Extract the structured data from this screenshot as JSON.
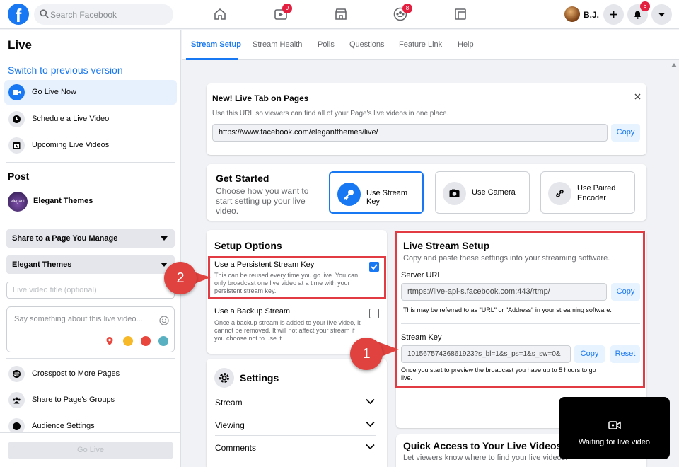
{
  "topbar": {
    "search_placeholder": "Search Facebook",
    "nav": [
      {
        "name": "home",
        "badge": ""
      },
      {
        "name": "watch",
        "badge": "9"
      },
      {
        "name": "marketplace",
        "badge": ""
      },
      {
        "name": "groups",
        "badge": "8"
      },
      {
        "name": "gaming",
        "badge": ""
      }
    ],
    "profile_name": "B.J.",
    "notifications_badge": "6"
  },
  "sidebar": {
    "title": "Live",
    "switch_link": "Switch to previous version",
    "items": [
      {
        "label": "Go Live Now",
        "active": true
      },
      {
        "label": "Schedule a Live Video"
      },
      {
        "label": "Upcoming Live Videos"
      }
    ],
    "post_heading": "Post",
    "page_name": "Elegant Themes",
    "page_avatar_text": "elegant",
    "share_dropdown": "Share to a Page You Manage",
    "page_dropdown": "Elegant Themes",
    "title_placeholder": "Live video title (optional)",
    "description_placeholder": "Say something about this live video...",
    "bottom_items": [
      {
        "label": "Crosspost to More Pages"
      },
      {
        "label": "Share to Page's Groups"
      },
      {
        "label": "Audience Settings"
      }
    ],
    "go_live_button": "Go Live"
  },
  "tabs": [
    "Stream Setup",
    "Stream Health",
    "Polls",
    "Questions",
    "Feature Link",
    "Help"
  ],
  "live_tab_card": {
    "title": "New! Live Tab on Pages",
    "description": "Use this URL so viewers can find all of your Page's live videos in one place.",
    "url": "https://www.facebook.com/elegantthemes/live/",
    "copy": "Copy"
  },
  "get_started": {
    "title": "Get Started",
    "description": "Choose how you want to start setting up your live video.",
    "options": [
      {
        "label": "Use Stream Key",
        "selected": true
      },
      {
        "label": "Use Camera"
      },
      {
        "label": "Use Paired Encoder"
      }
    ]
  },
  "setup_options": {
    "title": "Setup Options",
    "persistent": {
      "label": "Use a Persistent Stream Key",
      "desc": "This can be reused every time you go live. You can only broadcast one live video at a time with your persistent stream key.",
      "checked": true
    },
    "backup": {
      "label": "Use a Backup Stream",
      "desc": "Once a backup stream is added to your live video, it cannot be removed. It will not affect your stream if you choose not to use it.",
      "checked": false
    }
  },
  "settings": {
    "title": "Settings",
    "rows": [
      "Stream",
      "Viewing",
      "Comments"
    ]
  },
  "live_stream_setup": {
    "title": "Live Stream Setup",
    "description": "Copy and paste these settings into your streaming software.",
    "server_url_label": "Server URL",
    "server_url": "rtmps://live-api-s.facebook.com:443/rtmp/",
    "server_note": "This may be referred to as \"URL\" or \"Address\" in your streaming software.",
    "stream_key_label": "Stream Key",
    "stream_key": "10156757436861923?s_bl=1&s_ps=1&s_sw=0&",
    "stream_note": "Once you start to preview the broadcast you have up to 5 hours to go live.",
    "copy": "Copy",
    "reset": "Reset"
  },
  "quick_access": {
    "title": "Quick Access to Your Live Videos",
    "description": "Let viewers know where to find your live videos."
  },
  "callouts": [
    "1",
    "2"
  ],
  "toast": {
    "text": "Waiting for live video"
  },
  "colors": {
    "accent": "#1877f2",
    "highlight": "#e33b44",
    "callout": "#e0423f"
  }
}
